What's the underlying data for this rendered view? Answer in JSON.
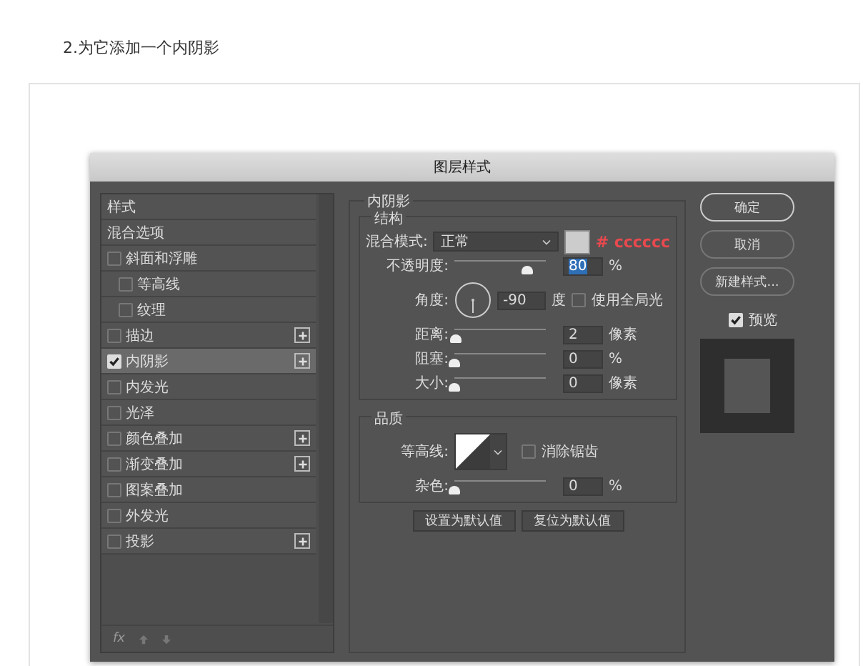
{
  "heading": "2.为它添加一个内阴影",
  "dialog": {
    "title": "图层样式",
    "style_list": [
      {
        "kind": "header",
        "label": "样式",
        "selected": false
      },
      {
        "kind": "header",
        "label": "混合选项",
        "selected": false
      },
      {
        "kind": "effect",
        "label": "斜面和浮雕",
        "checked": false,
        "selected": false,
        "add_button": false,
        "children": [
          {
            "kind": "effect",
            "label": "等高线",
            "checked": false,
            "selected": false,
            "add_button": false
          },
          {
            "kind": "effect",
            "label": "纹理",
            "checked": false,
            "selected": false,
            "add_button": false
          }
        ]
      },
      {
        "kind": "effect",
        "label": "描边",
        "checked": false,
        "selected": false,
        "add_button": true
      },
      {
        "kind": "effect",
        "label": "内阴影",
        "checked": true,
        "selected": true,
        "add_button": true
      },
      {
        "kind": "effect",
        "label": "内发光",
        "checked": false,
        "selected": false,
        "add_button": false
      },
      {
        "kind": "effect",
        "label": "光泽",
        "checked": false,
        "selected": false,
        "add_button": false
      },
      {
        "kind": "effect",
        "label": "颜色叠加",
        "checked": false,
        "selected": false,
        "add_button": true
      },
      {
        "kind": "effect",
        "label": "渐变叠加",
        "checked": false,
        "selected": false,
        "add_button": true
      },
      {
        "kind": "effect",
        "label": "图案叠加",
        "checked": false,
        "selected": false,
        "add_button": false
      },
      {
        "kind": "effect",
        "label": "外发光",
        "checked": false,
        "selected": false,
        "add_button": false
      },
      {
        "kind": "effect",
        "label": "投影",
        "checked": false,
        "selected": false,
        "add_button": true
      }
    ],
    "footer_fx": "fx",
    "panel": {
      "title": "内阴影",
      "structure": {
        "title": "结构",
        "blend_mode": {
          "label": "混合模式:",
          "value": "正常"
        },
        "color_note": "# cccccc",
        "opacity": {
          "label": "不透明度:",
          "level": 0.8,
          "value": "80",
          "unit": "%",
          "focused": true
        },
        "angle": {
          "label": "角度:",
          "value": "-90",
          "unit": "度"
        },
        "global_light": {
          "label": "使用全局光",
          "checked": false
        },
        "sliders": [
          {
            "label": "距离:",
            "level": 0.02,
            "value": "2",
            "unit": "像素"
          },
          {
            "label": "阻塞:",
            "level": 0,
            "value": "0",
            "unit": "%"
          },
          {
            "label": "大小:",
            "level": 0,
            "value": "0",
            "unit": "像素"
          }
        ]
      },
      "quality": {
        "title": "品质",
        "contour_label": "等高线:",
        "anti_alias": {
          "label": "消除锯齿",
          "checked": false
        },
        "noise": {
          "label": "杂色:",
          "level": 0,
          "value": "0",
          "unit": "%"
        }
      },
      "buttons": [
        "设置为默认值",
        "复位为默认值"
      ]
    },
    "side_buttons": [
      "确定",
      "取消",
      "新建样式..."
    ],
    "preview": {
      "label": "预览",
      "checked": true
    }
  }
}
